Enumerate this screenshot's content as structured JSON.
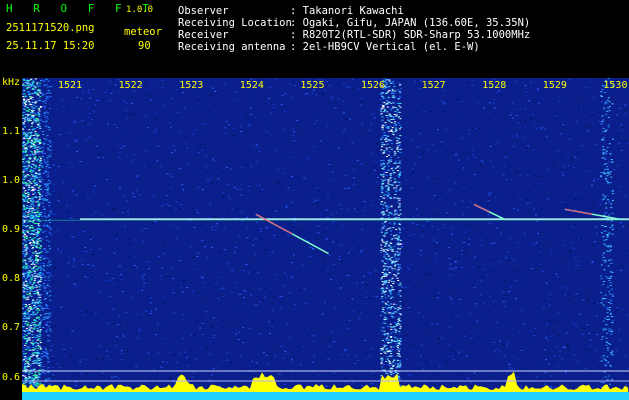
{
  "app": {
    "title": "H R O F F T",
    "version": "1.0.0"
  },
  "file": {
    "name": "2511171520.png",
    "timestamp": "25.11.17 15:20"
  },
  "stat": {
    "type": "meteor",
    "count": "90"
  },
  "info": {
    "observer_label": "Observer",
    "observer_value": ": Takanori Kawachi",
    "location_label": "Receiving Location",
    "location_value": ": Ogaki, Gifu, JAPAN (136.60E, 35.35N)",
    "receiver_label": "Receiver",
    "receiver_value": ": R820T2(RTL-SDR) SDR-Sharp 53.1000MHz",
    "antenna_label": "Receiving antenna",
    "antenna_value": ": 2el-HB9CV Vertical (el. E-W)"
  },
  "chart_data": {
    "type": "heatmap",
    "x_axis": {
      "ticks": [
        "1521",
        "1522",
        "1523",
        "1524",
        "1525",
        "1526",
        "1527",
        "1528",
        "1529",
        "1530"
      ]
    },
    "y_axis": {
      "unit": "kHz",
      "ticks": [
        "1.1",
        "1.0",
        "0.9",
        "0.8",
        "0.7",
        "0.6"
      ],
      "range": [
        0.57,
        1.15
      ]
    },
    "carrier_khz": 0.92,
    "meteor_echoes": [
      {
        "start_x": 1524.1,
        "start_y": 0.93,
        "end_x": 1525.3,
        "end_y": 0.85
      },
      {
        "start_x": 1527.7,
        "start_y": 0.95,
        "end_x": 1528.2,
        "end_y": 0.92
      },
      {
        "start_x": 1529.2,
        "start_y": 0.94,
        "end_x": 1530.1,
        "end_y": 0.92
      }
    ],
    "colors": {
      "background": "#0a1f8c",
      "carrier": "#bfffff",
      "echo": "#ff3060",
      "bottom_band": "#ffff00",
      "labels": "#ffff00"
    }
  }
}
